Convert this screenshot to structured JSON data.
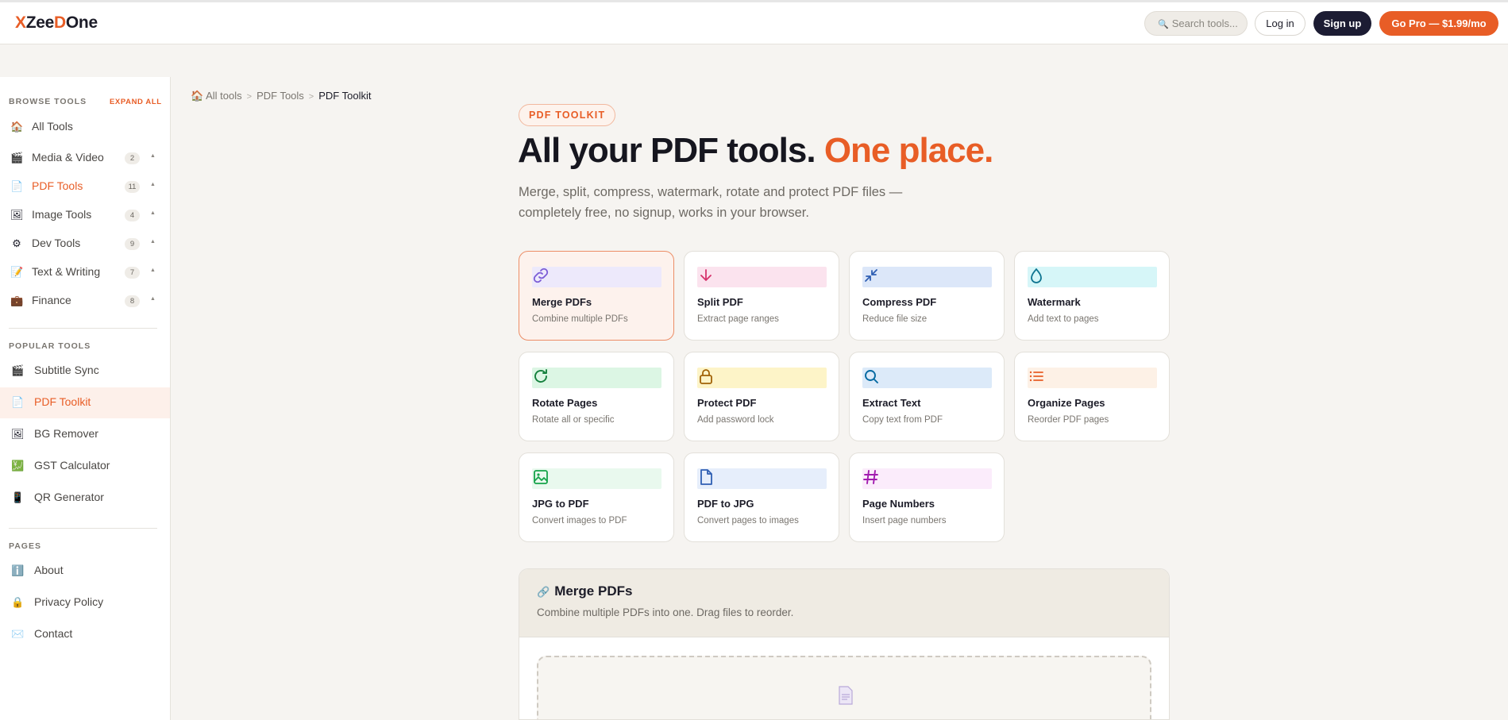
{
  "header": {
    "logo_parts": [
      "X",
      "Zee",
      "D",
      "One"
    ],
    "search_placeholder": "Search tools...",
    "login_label": "Log in",
    "signup_label": "Sign up",
    "pro_label": "Go Pro — $1.99/mo"
  },
  "sidebar": {
    "browse_title": "BROWSE TOOLS",
    "expand_label": "EXPAND ALL",
    "categories": [
      {
        "label": "All Tools",
        "icon": "house-icon",
        "count": ""
      },
      {
        "label": "Media & Video",
        "icon": "clapper-icon",
        "count": "2"
      },
      {
        "label": "PDF Tools",
        "icon": "document-icon",
        "count": "11"
      },
      {
        "label": "Image Tools",
        "icon": "picture-icon",
        "count": "4"
      },
      {
        "label": "Dev Tools",
        "icon": "gear-icon",
        "count": "9"
      },
      {
        "label": "Text & Writing",
        "icon": "pencil-icon",
        "count": "7"
      },
      {
        "label": "Finance",
        "icon": "briefcase-icon",
        "count": "8"
      }
    ],
    "popular_title": "POPULAR TOOLS",
    "popular": [
      {
        "label": "Subtitle Sync",
        "icon": "clapper-icon"
      },
      {
        "label": "PDF Toolkit",
        "icon": "document-icon"
      },
      {
        "label": "BG Remover",
        "icon": "picture-icon"
      },
      {
        "label": "GST Calculator",
        "icon": "chart-icon"
      },
      {
        "label": "QR Generator",
        "icon": "phone-icon"
      }
    ],
    "pages_title": "PAGES",
    "pages": [
      {
        "label": "About",
        "icon": "info-icon"
      },
      {
        "label": "Privacy Policy",
        "icon": "lock-icon"
      },
      {
        "label": "Contact",
        "icon": "envelope-icon"
      }
    ]
  },
  "breadcrumb": [
    "All tools",
    "PDF Tools",
    "PDF Toolkit"
  ],
  "hero": {
    "badge": "PDF TOOLKIT",
    "title_main": "All your PDF tools.",
    "title_accent": "One place.",
    "subtitle": "Merge, split, compress, watermark, rotate and protect PDF files — completely free, no signup, works in your browser."
  },
  "tools": [
    {
      "title": "Merge PDFs",
      "desc": "Combine multiple PDFs",
      "icon": "link-icon",
      "color": "#7b5cd6",
      "band": "#ede9fb",
      "selected": true
    },
    {
      "title": "Split PDF",
      "desc": "Extract page ranges",
      "icon": "arrow-down-icon",
      "color": "#d6336c",
      "band": "#fbe3ee"
    },
    {
      "title": "Compress PDF",
      "desc": "Reduce file size",
      "icon": "compress-icon",
      "color": "#2f5fb3",
      "band": "#dce7f9"
    },
    {
      "title": "Watermark",
      "desc": "Add text to pages",
      "icon": "droplet-icon",
      "color": "#0e7490",
      "band": "#d6f6f8"
    },
    {
      "title": "Rotate Pages",
      "desc": "Rotate all or specific",
      "icon": "rotate-icon",
      "color": "#15803d",
      "band": "#dcf6e4"
    },
    {
      "title": "Protect PDF",
      "desc": "Add password lock",
      "icon": "lock-icon",
      "color": "#a16207",
      "band": "#fdf4c8"
    },
    {
      "title": "Extract Text",
      "desc": "Copy text from PDF",
      "icon": "search-icon",
      "color": "#0369a1",
      "band": "#dceaf9"
    },
    {
      "title": "Organize Pages",
      "desc": "Reorder PDF pages",
      "icon": "list-icon",
      "color": "#e85d26",
      "band": "#fdf1e6"
    },
    {
      "title": "JPG to PDF",
      "desc": "Convert images to PDF",
      "icon": "image-icon",
      "color": "#16a34a",
      "band": "#e9f9ee"
    },
    {
      "title": "PDF to JPG",
      "desc": "Convert pages to images",
      "icon": "file-icon",
      "color": "#2f5fb3",
      "band": "#e6eefb"
    },
    {
      "title": "Page Numbers",
      "desc": "Insert page numbers",
      "icon": "hash-icon",
      "color": "#a21caf",
      "band": "#fbecfb"
    }
  ],
  "panel": {
    "title": "Merge PDFs",
    "subtitle": "Combine multiple PDFs into one. Drag files to reorder."
  }
}
